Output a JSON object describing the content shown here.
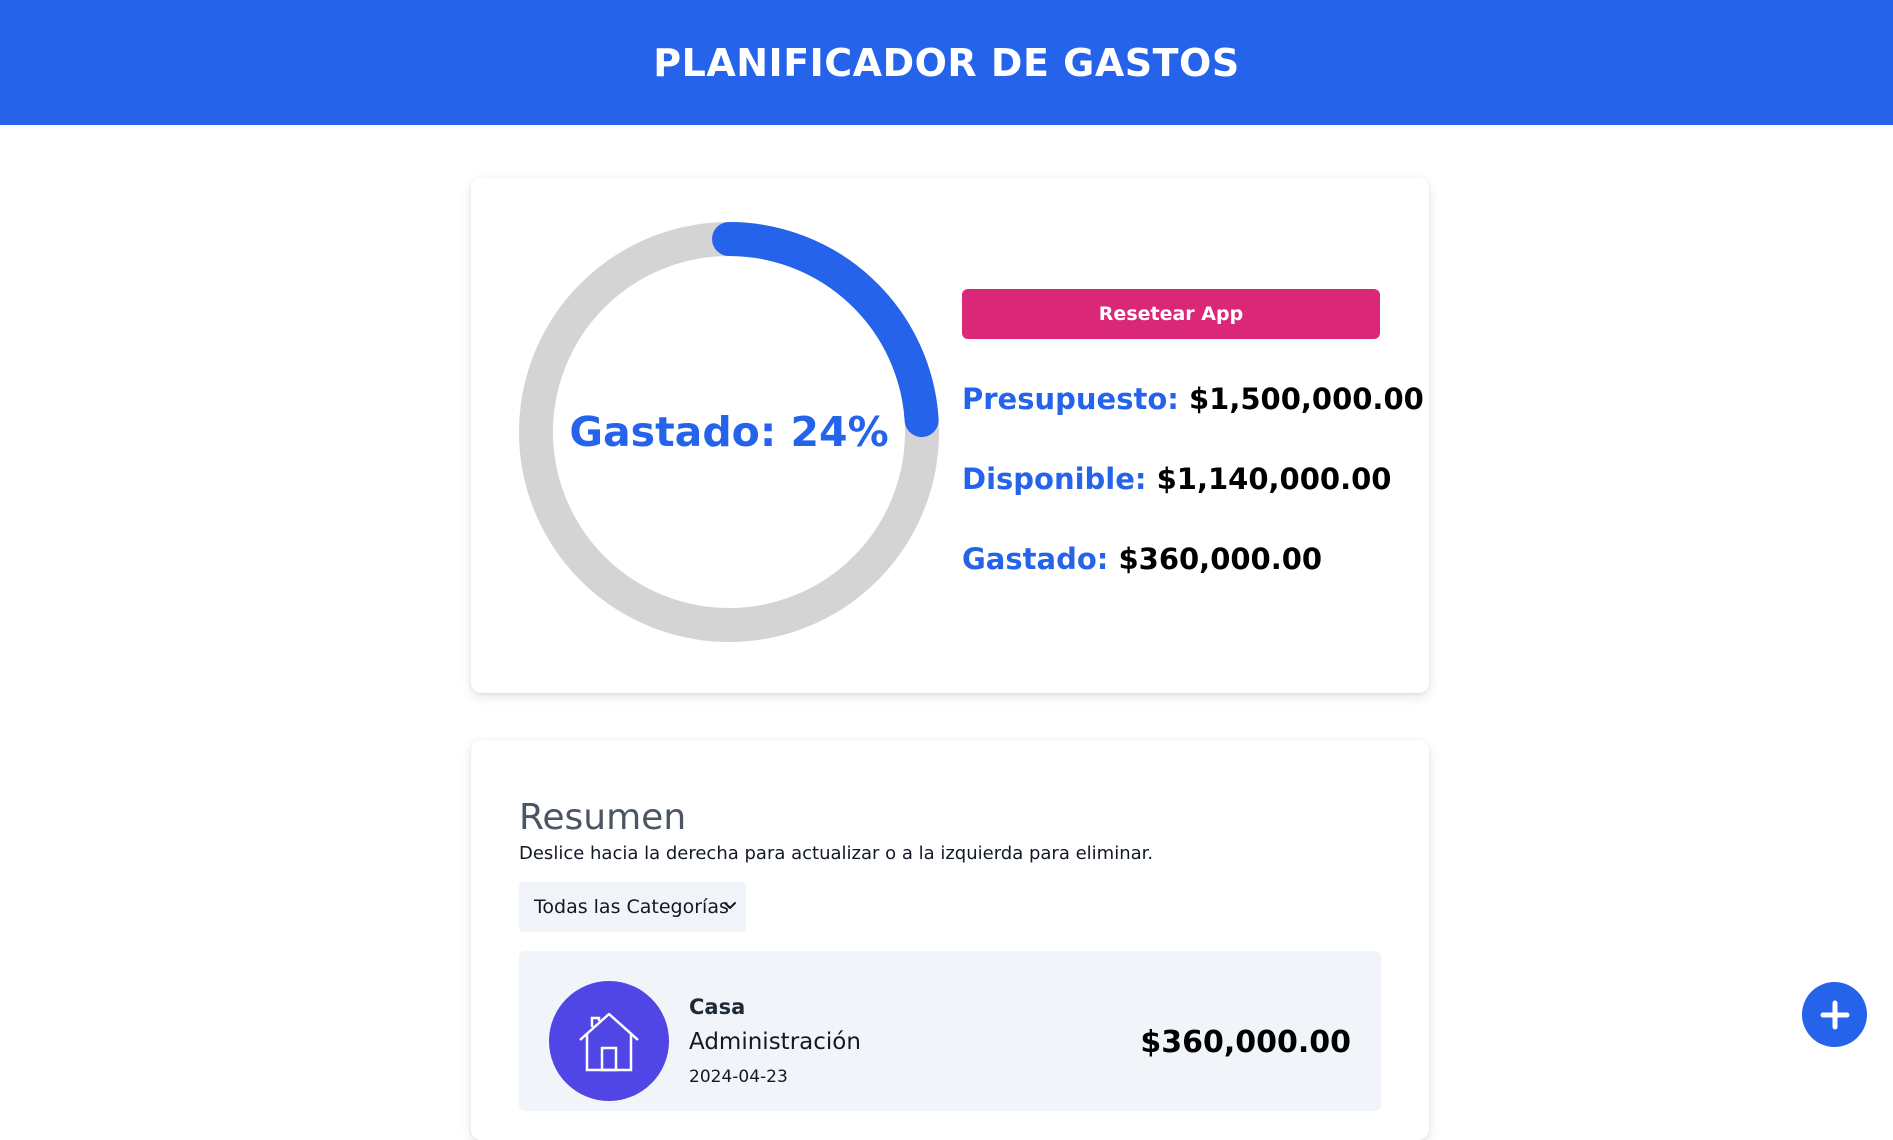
{
  "header": {
    "title": "PLANIFICADOR DE GASTOS"
  },
  "budget": {
    "progress": {
      "label": "Gastado: 24%",
      "percent": 24
    },
    "reset_label": "Resetear App",
    "presupuesto_label": "Presupuesto:",
    "presupuesto_value": "$1,500,000.00",
    "disponible_label": "Disponible:",
    "disponible_value": "$1,140,000.00",
    "gastado_label": "Gastado:",
    "gastado_value": "$360,000.00"
  },
  "summary": {
    "title": "Resumen",
    "description": "Deslice hacia la derecha para actualizar o a la izquierda para eliminar.",
    "filter_selected": "Todas las Categorías",
    "expenses": [
      {
        "icon": "house-icon",
        "category": "Casa",
        "name": "Administración",
        "date": "2024-04-23",
        "amount": "$360,000.00"
      }
    ]
  },
  "colors": {
    "primary": "#2563eb",
    "accent": "#db2777",
    "track": "#d4d4d4",
    "category_icon_bg": "#4f46e5"
  }
}
